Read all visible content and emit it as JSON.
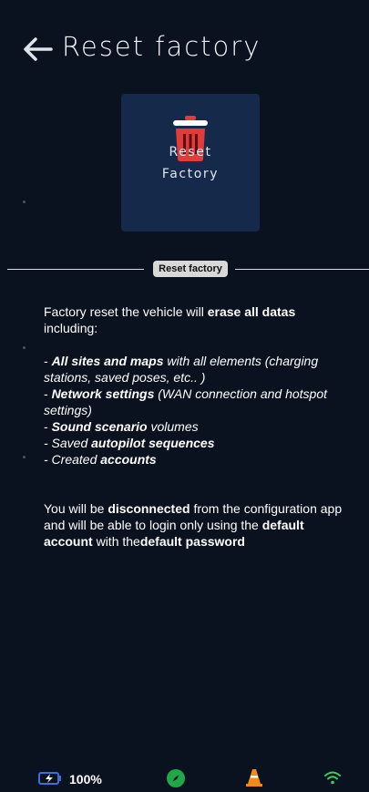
{
  "header": {
    "title": "Reset factory",
    "back_icon": "arrow-left-icon"
  },
  "reset_card": {
    "icon": "trash-icon",
    "icon_color": "#e03c3c",
    "label_line1": "Reset",
    "label_line2": "Factory"
  },
  "divider": {
    "label": "Reset factory"
  },
  "content": {
    "intro_pre": "Factory reset the vehicle will ",
    "intro_bold": "erase all datas",
    "intro_post": " including:",
    "items": [
      {
        "prefix": "- ",
        "bold": "All sites and maps",
        "rest": " with all elements (charging stations, saved poses, etc.. )"
      },
      {
        "prefix": "- ",
        "bold": "Network settings",
        "rest": " (WAN connection and hotspot settings)"
      },
      {
        "prefix": "- ",
        "bold": "Sound scenario",
        "rest": " volumes"
      },
      {
        "prefix": "- Saved ",
        "bold": "autopilot sequences",
        "rest": ""
      },
      {
        "prefix": "- Created ",
        "bold": "accounts",
        "rest": ""
      }
    ],
    "outro_1": "You will be ",
    "outro_2": "disconnected",
    "outro_3": " from the configuration app and will be able to login only using the ",
    "outro_4": "default account",
    "outro_5": " with the",
    "outro_6": "default password"
  },
  "status_bar": {
    "battery_icon": "battery-charging-icon",
    "battery_level": "100%",
    "compass_icon": "compass-icon",
    "compass_color": "#1fa845",
    "cone_icon": "traffic-cone-icon",
    "cone_color": "#f08a1c",
    "wifi_icon": "wifi-icon",
    "wifi_color": "#3ccf5a"
  }
}
